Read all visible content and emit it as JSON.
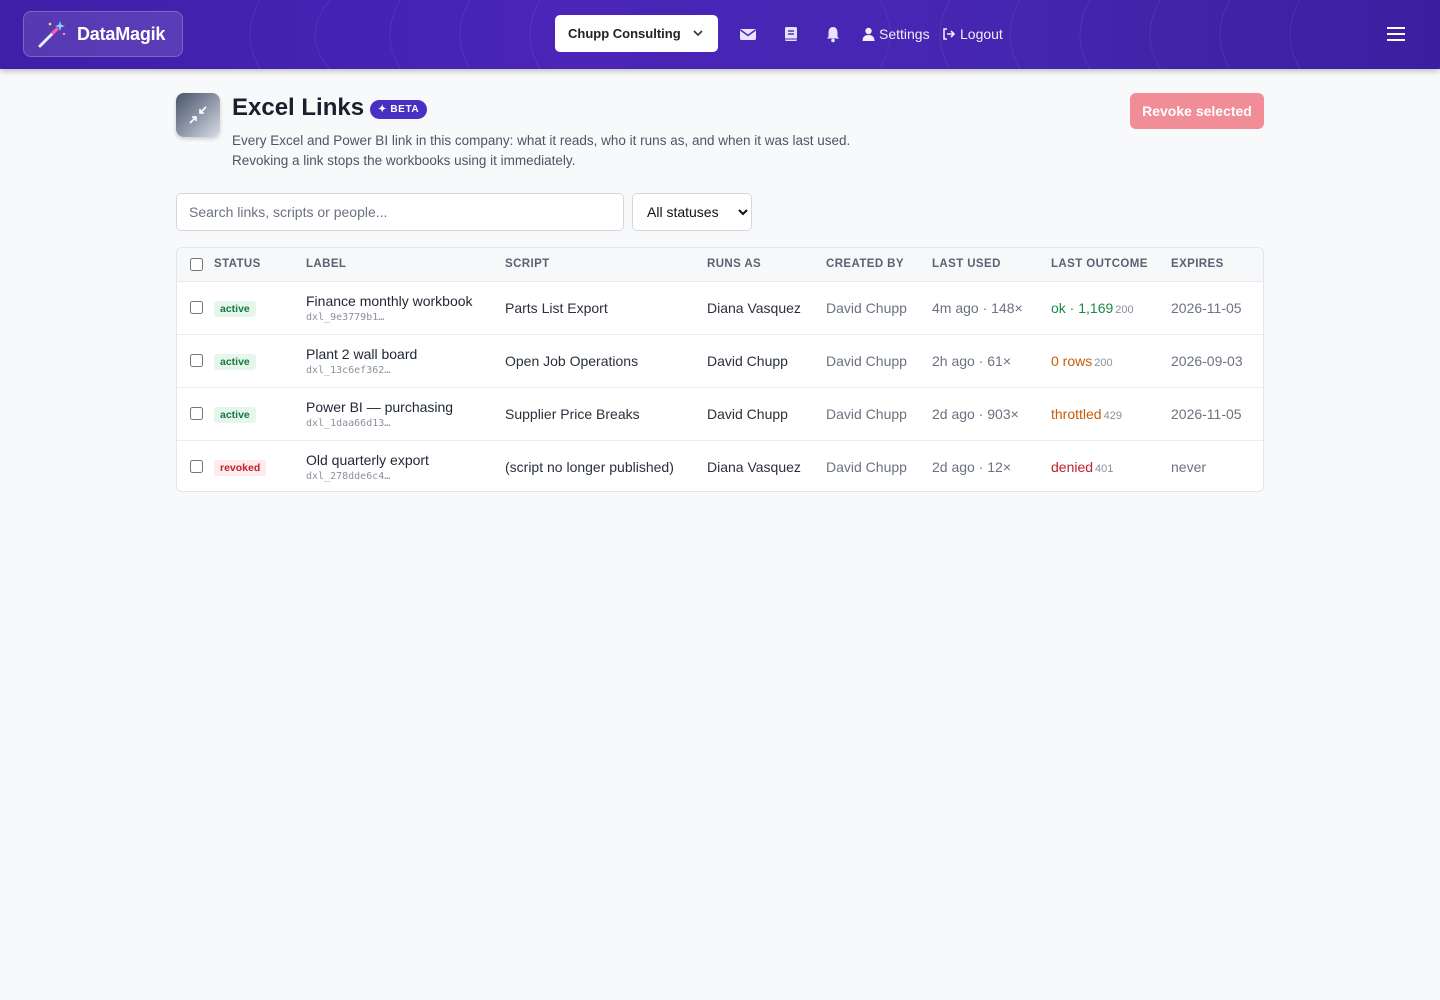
{
  "navbar": {
    "brand": "DataMagik",
    "company": "Chupp Consulting",
    "icons": [
      "mail-icon",
      "book-icon",
      "bell-icon"
    ],
    "settings_label": "Settings",
    "logout_label": "Logout"
  },
  "header": {
    "title": "Excel Links",
    "badge": "✦ BETA",
    "subtitle_line1": "Every Excel and Power BI link in this company: what it reads, who it runs as, and when it was last used.",
    "subtitle_line2": "Revoking a link stops the workbooks using it immediately.",
    "revoke_button": "Revoke selected"
  },
  "filters": {
    "search_placeholder": "Search links, scripts or people...",
    "status_selected": "All statuses"
  },
  "table": {
    "columns": [
      "Status",
      "Label",
      "Script",
      "Runs as",
      "Created by",
      "Last used",
      "Last outcome",
      "Expires"
    ],
    "rows": [
      {
        "status": "active",
        "label": "Finance monthly workbook",
        "id": "dxl_9e3779b1…",
        "script": "Parts List Export",
        "runs_as": "Diana Vasquez",
        "created_by": "David Chupp",
        "last_used": "4m ago · 148×",
        "outcome": "ok · 1,169",
        "outcome_code": "200",
        "outcome_kind": "ok",
        "expires": "2026-11-05"
      },
      {
        "status": "active",
        "label": "Plant 2 wall board",
        "id": "dxl_13c6ef362…",
        "script": "Open Job Operations",
        "runs_as": "David Chupp",
        "created_by": "David Chupp",
        "last_used": "2h ago · 61×",
        "outcome": "0 rows",
        "outcome_code": "200",
        "outcome_kind": "warn",
        "expires": "2026-09-03"
      },
      {
        "status": "active",
        "label": "Power BI — purchasing",
        "id": "dxl_1daa66d13…",
        "script": "Supplier Price Breaks",
        "runs_as": "David Chupp",
        "created_by": "David Chupp",
        "last_used": "2d ago · 903×",
        "outcome": "throttled",
        "outcome_code": "429",
        "outcome_kind": "warn",
        "expires": "2026-11-05"
      },
      {
        "status": "revoked",
        "label": "Old quarterly export",
        "id": "dxl_278dde6c4…",
        "script": "(script no longer published)",
        "runs_as": "Diana Vasquez",
        "created_by": "David Chupp",
        "last_used": "2d ago · 12×",
        "outcome": "denied",
        "outcome_code": "401",
        "outcome_kind": "bad",
        "expires": "never"
      }
    ]
  },
  "colors": {
    "navbar": "#4526b0",
    "beta": "#4a2fc4",
    "revoke_button": "#f08d97",
    "ok": "#1a8a45",
    "warn": "#c75e0a",
    "bad": "#c0202a"
  }
}
